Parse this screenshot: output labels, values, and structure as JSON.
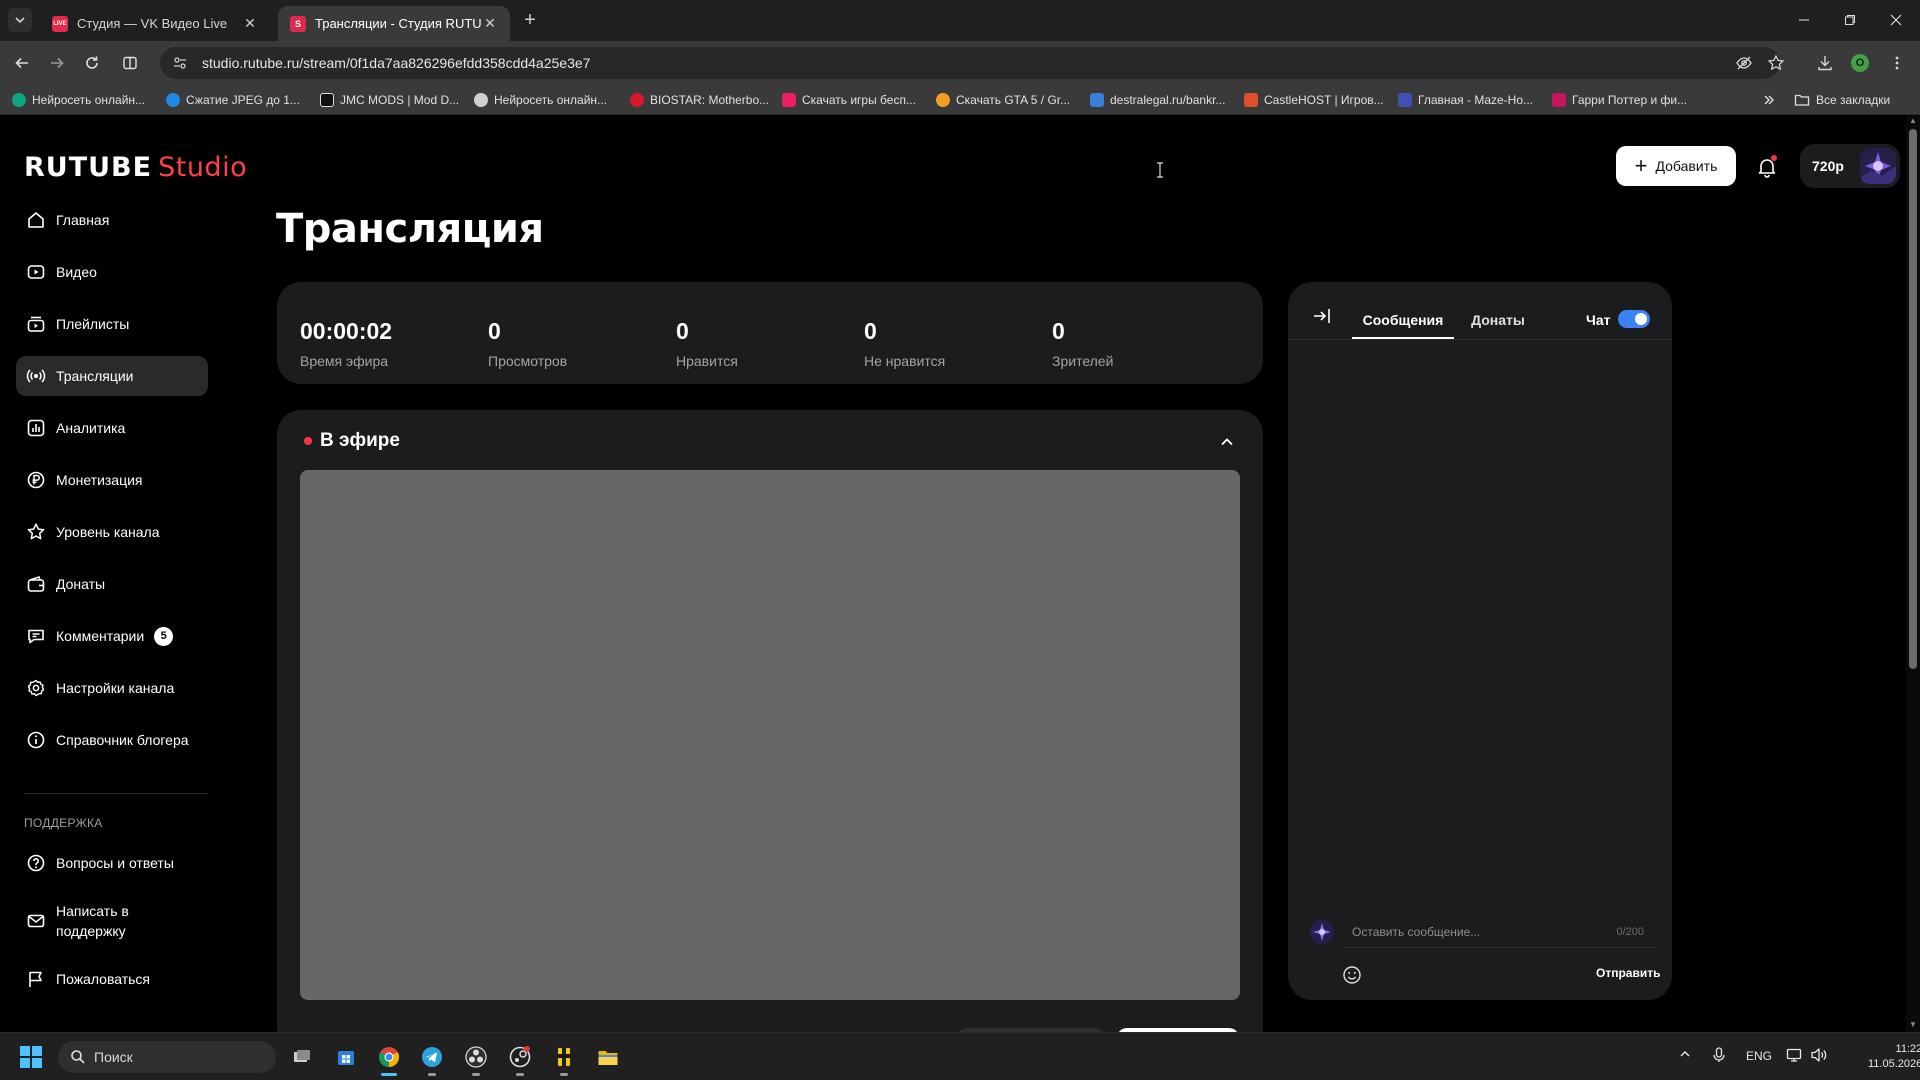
{
  "browser": {
    "tabs": [
      {
        "title": "Студия — VK Видео Live",
        "favicon_color": "#e5294a",
        "favicon_text": "LIVE",
        "active": false
      },
      {
        "title": "Трансляции - Студия RUTUBE",
        "favicon_color": "#e02a4c",
        "favicon_text": "S",
        "active": true
      }
    ],
    "url": "studio.rutube.ru/stream/0f1da7aa826296efdd358cdd4a25e3e7",
    "profile_initial": "O",
    "bookmarks": [
      {
        "label": "Нейросеть онлайн...",
        "icon_color": "#10a37f"
      },
      {
        "label": "Сжатие JPEG до 1...",
        "icon_color": "#1e88e5"
      },
      {
        "label": "JMC MODS | Mod D...",
        "icon_color": "#111111"
      },
      {
        "label": "Нейросеть онлайн...",
        "icon_color": "#d0d0d0"
      },
      {
        "label": "BIOSTAR: Motherbo...",
        "icon_color": "#d7192a"
      },
      {
        "label": "Скачать игры бесп...",
        "icon_color": "#e91e63"
      },
      {
        "label": "Скачать GTA 5 / Gr...",
        "icon_color": "#f0a020"
      },
      {
        "label": "destralegal.ru/bankr...",
        "icon_color": "#3b7ddd"
      },
      {
        "label": "CastleHOST | Игров...",
        "icon_color": "#e04e2a"
      },
      {
        "label": "Главная - Maze-Ho...",
        "icon_color": "#3f51b5"
      },
      {
        "label": "Гарри Поттер и фи...",
        "icon_color": "#c2185b"
      }
    ],
    "all_bookmarks_label": "Все закладки"
  },
  "app": {
    "logo_main": "RUTUBE",
    "logo_studio": "Studio",
    "brand_color": "#ff3f4a",
    "header": {
      "add_label": "Добавить",
      "quality_label": "720p"
    },
    "sidebar": {
      "items": [
        {
          "label": "Главная",
          "icon": "home-icon"
        },
        {
          "label": "Видео",
          "icon": "video-icon"
        },
        {
          "label": "Плейлисты",
          "icon": "playlist-icon"
        },
        {
          "label": "Трансляции",
          "icon": "broadcast-icon",
          "active": true
        },
        {
          "label": "Аналитика",
          "icon": "analytics-icon"
        },
        {
          "label": "Монетизация",
          "icon": "ruble-icon"
        },
        {
          "label": "Уровень канала",
          "icon": "star-icon"
        },
        {
          "label": "Донаты",
          "icon": "wallet-icon"
        },
        {
          "label": "Комментарии",
          "icon": "comments-icon",
          "badge": "5"
        },
        {
          "label": "Настройки канала",
          "icon": "gear-icon"
        },
        {
          "label": "Справочник блогера",
          "icon": "info-icon"
        }
      ],
      "support_title": "ПОДДЕРЖКА",
      "support_items": [
        {
          "label": "Вопросы и ответы",
          "icon": "question-icon"
        },
        {
          "label": "Написать в поддержку",
          "icon": "mail-icon"
        },
        {
          "label": "Пожаловаться",
          "icon": "flag-icon"
        }
      ]
    },
    "main": {
      "title": "Трансляция",
      "stats": [
        {
          "value": "00:00:02",
          "label": "Время эфира"
        },
        {
          "value": "0",
          "label": "Просмотров"
        },
        {
          "value": "0",
          "label": "Нравится"
        },
        {
          "value": "0",
          "label": "Не нравится"
        },
        {
          "value": "0",
          "label": "Зрителей"
        }
      ],
      "live_label": "В эфире",
      "live_color": "#ff3347"
    },
    "chat": {
      "tab_messages": "Сообщения",
      "tab_donations": "Донаты",
      "chat_label": "Чат",
      "chat_enabled": true,
      "toggle_color": "#3b82f6",
      "input_placeholder": "Оставить сообщение...",
      "counter": "0/200",
      "send_label": "Отправить"
    }
  },
  "taskbar": {
    "search_placeholder": "Поиск",
    "language": "ENG",
    "time": "11:22",
    "date": "11.05.2026"
  }
}
